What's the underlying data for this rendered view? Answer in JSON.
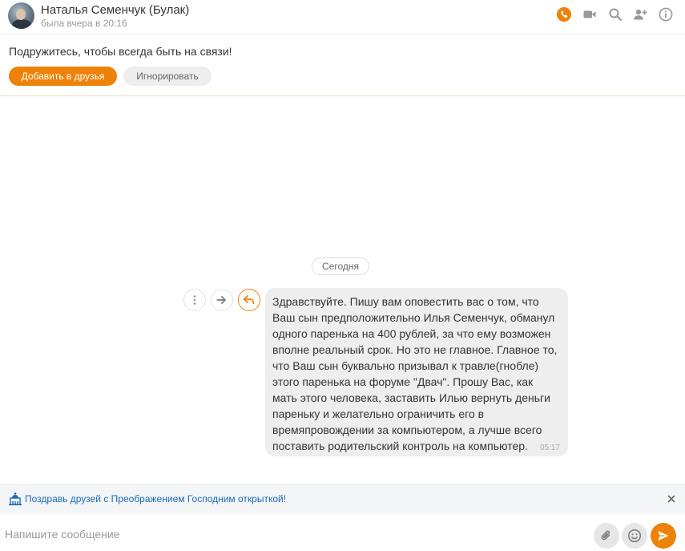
{
  "header": {
    "name": "Наталья Семенчук (Булак)",
    "status": "была вчера в 20:16",
    "icons": [
      "phone-icon",
      "video-camera-icon",
      "search-icon",
      "add-friend-icon",
      "info-icon"
    ]
  },
  "friend_prompt": {
    "text": "Подружитесь, чтобы всегда быть на связи!",
    "add_label": "Добавить в друзья",
    "ignore_label": "Игнорировать"
  },
  "chat": {
    "date_label": "Сегодня",
    "message": {
      "text": "Здравствуйте. Пишу вам оповестить вас о том, что Ваш сын предположительно Илья Семенчук, обманул одного паренька на 400 рублей, за что ему возможен вполне реальный срок. Но это не главное. Главное то, что Ваш сын буквально призывал к травле(гнобле) этого паренька на форуме \"Двач\". Прошу Вас, как мать этого человека, заставить Илью вернуть деньги пареньку и желательно ограничить его в времяпровождении за компьютером, а лучше всего поставить родительский контроль на компьютер.",
      "time": "05:17"
    }
  },
  "promo": {
    "text": "Поздравь друзей с Преображением Господним открыткой!"
  },
  "composer": {
    "placeholder": "Напишите сообщение"
  },
  "colors": {
    "accent": "#ee8208",
    "link": "#1c6ab8",
    "bubble": "#eeeeee"
  }
}
